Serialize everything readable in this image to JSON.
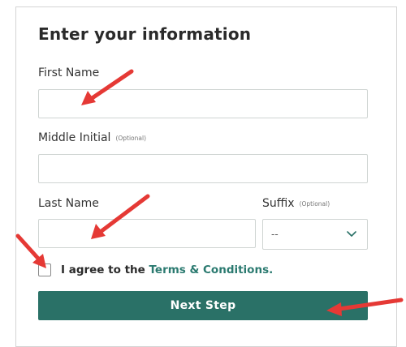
{
  "form": {
    "title": "Enter your information",
    "first_name": {
      "label": "First Name",
      "value": ""
    },
    "middle_initial": {
      "label": "Middle Initial",
      "optional": "(Optional)",
      "value": ""
    },
    "last_name": {
      "label": "Last Name",
      "value": ""
    },
    "suffix": {
      "label": "Suffix",
      "optional": "(Optional)",
      "selected": "--"
    },
    "terms": {
      "prefix": "I agree to the ",
      "link": "Terms & Conditions.",
      "checked": false
    },
    "submit_label": "Next Step"
  },
  "annotations": {
    "arrow_color": "#e53935",
    "arrows": [
      "pointing to first name field",
      "pointing to last name field",
      "pointing to terms checkbox",
      "pointing to next step button"
    ]
  },
  "colors": {
    "accent": "#2a7167",
    "link": "#2b7a70",
    "text": "#2a2a2a"
  }
}
